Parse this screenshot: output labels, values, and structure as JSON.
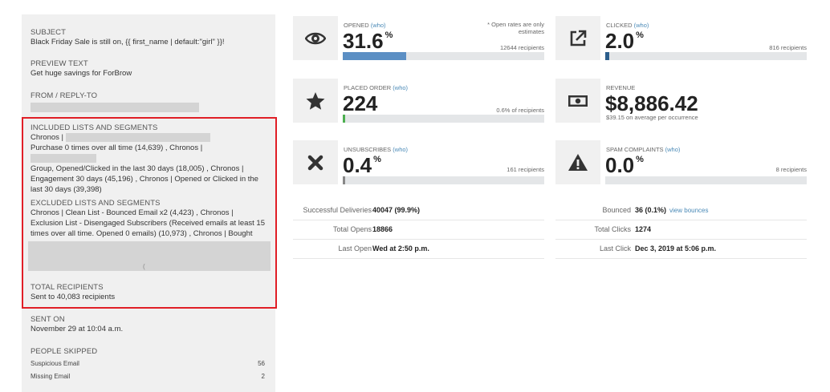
{
  "colors": {
    "accent_link": "#4a8ab7",
    "bar_fill_opened": "#5b8fc4",
    "bar_fill_clicked": "#2c5e8c",
    "bar_fill_order": "#4caf50",
    "bar_track": "#e4e6e8",
    "highlight_border": "#e01e26"
  },
  "summary": {
    "subject_label": "SUBJECT",
    "subject_value": "Black Friday Sale is still on, {{ first_name | default:\"girl\" }}!",
    "preview_label": "PREVIEW TEXT",
    "preview_value": "Get huge savings for ForBrow",
    "from_label": "FROM / REPLY-TO",
    "included_label": "INCLUDED LISTS AND SEGMENTS",
    "included_text_1": "Chronos |",
    "included_text_2": "Purchase 0 times over all time (14,639) , Chronos |",
    "included_text_3": "Group, Opened/Clicked in the last 30 days (18,005) , Chronos |",
    "included_text_4": "Engagement 30 days (45,196) , Chronos | Opened or Clicked in the",
    "included_text_5": "last 30 days (39,398)",
    "excluded_label": "EXCLUDED LISTS AND SEGMENTS",
    "excluded_text_1": "Chronos | Clean List - Bounced Email x2 (4,423) , Chronos |",
    "excluded_text_2": "Exclusion List - Disengaged Subscribers (Received emails at least 15",
    "excluded_text_3": "times over all time. Opened 0 emails) (10,973) , Chronos | Bought",
    "excluded_text_4": "(",
    "total_label": "TOTAL RECIPIENTS",
    "total_value": "Sent to 40,083 recipients",
    "sent_label": "SENT ON",
    "sent_value": "November 29 at 10:04 a.m.",
    "skipped_label": "PEOPLE SKIPPED",
    "skipped": [
      {
        "label": "Suspicious Email",
        "value": "56"
      },
      {
        "label": "Missing Email",
        "value": "2"
      }
    ]
  },
  "metrics": {
    "opened": {
      "label": "OPENED",
      "who": "(who)",
      "value": "31.6",
      "unit": "%",
      "note": "* Open rates are only estimates",
      "recipients": "12644 recipients",
      "fill": 0.316,
      "icon": "eye-icon"
    },
    "clicked": {
      "label": "CLICKED",
      "who": "(who)",
      "value": "2.0",
      "unit": "%",
      "recipients": "816 recipients",
      "fill": 0.02,
      "icon": "external-link-icon"
    },
    "placed_order": {
      "label": "PLACED ORDER",
      "who": "(who)",
      "value": "224",
      "recipients": "0.6% of recipients",
      "fill": 0.006,
      "icon": "star-icon"
    },
    "revenue": {
      "label": "REVENUE",
      "value": "$8,886.42",
      "sub": "$39.15 on average per occurrence",
      "icon": "money-icon"
    },
    "unsubscribes": {
      "label": "UNSUBSCRIBES",
      "who": "(who)",
      "value": "0.4",
      "unit": "%",
      "recipients": "161 recipients",
      "fill": 0.004,
      "icon": "x-icon"
    },
    "spam": {
      "label": "SPAM COMPLAINTS",
      "who": "(who)",
      "value": "0.0",
      "unit": "%",
      "recipients": "8 recipients",
      "fill": 0.0,
      "icon": "warning-icon"
    }
  },
  "stats": {
    "successful_deliveries_label": "Successful Deliveries",
    "successful_deliveries_value": "40047 (99.9%)",
    "total_opens_label": "Total Opens",
    "total_opens_value": "18866",
    "last_open_label": "Last Open",
    "last_open_value": "Wed at 2:50 p.m.",
    "bounced_label": "Bounced",
    "bounced_value": "36 (0.1%)",
    "bounced_link": "view bounces",
    "total_clicks_label": "Total Clicks",
    "total_clicks_value": "1274",
    "last_click_label": "Last Click",
    "last_click_value": "Dec 3, 2019 at 5:06 p.m."
  }
}
